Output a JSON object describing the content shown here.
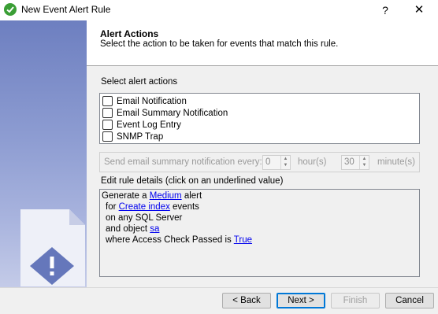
{
  "window": {
    "title": "New Event Alert Rule",
    "help_label": "?",
    "close_label": "✕"
  },
  "header": {
    "title": "Alert Actions",
    "subtitle": "Select the action to be taken for events that match this rule."
  },
  "actions": {
    "label": "Select alert actions",
    "items": [
      {
        "label": "Email Notification",
        "checked": false
      },
      {
        "label": "Email Summary Notification",
        "checked": false
      },
      {
        "label": "Event Log Entry",
        "checked": false
      },
      {
        "label": "SNMP Trap",
        "checked": false
      }
    ]
  },
  "summary_frequency": {
    "label": "Send email summary notification every:",
    "hours_value": "0",
    "hours_unit": "hour(s)",
    "minutes_value": "30",
    "minutes_unit": "minute(s)"
  },
  "details": {
    "label": "Edit rule details (click on an underlined value)",
    "line1_prefix": "Generate a ",
    "line1_link": "Medium",
    "line1_suffix": " alert",
    "line2_prefix": "for ",
    "line2_link": "Create index",
    "line2_suffix": " events",
    "line3": "on any SQL Server",
    "line4_prefix": "and object ",
    "line4_link": "sa",
    "line5_prefix": "where Access Check Passed is ",
    "line5_link": "True"
  },
  "buttons": {
    "back": "< Back",
    "next": "Next >",
    "finish": "Finish",
    "cancel": "Cancel"
  },
  "colors": {
    "accent": "#0078d7",
    "link": "#0000ee",
    "sidebar": "#7f8fca",
    "title_icon": "#3a9e35"
  }
}
